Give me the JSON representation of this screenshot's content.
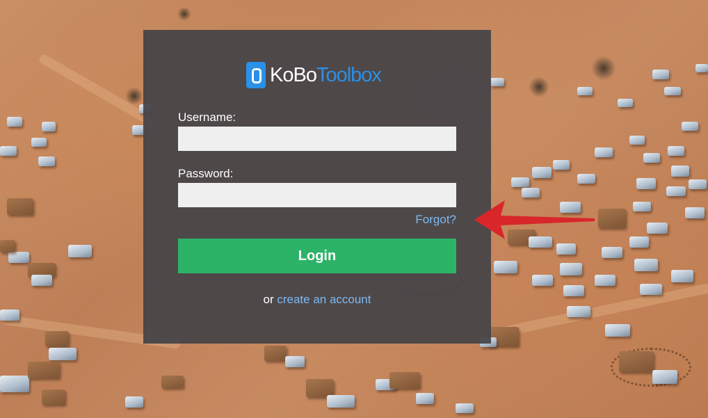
{
  "app": {
    "logo_primary": "KoBo",
    "logo_secondary": "Toolbox",
    "brand_color": "#2a90e8"
  },
  "form": {
    "username_label": "Username:",
    "username_value": "",
    "password_label": "Password:",
    "password_value": "",
    "forgot_link": "Forgot?",
    "login_button": "Login",
    "signup_prefix": "or",
    "signup_link": "create an account"
  },
  "colors": {
    "panel_bg": "#464448",
    "login_button": "#2db368",
    "link": "#7cbaf2",
    "annotation_arrow": "#d8262b"
  },
  "annotation": {
    "icon": "red-arrow-icon"
  }
}
